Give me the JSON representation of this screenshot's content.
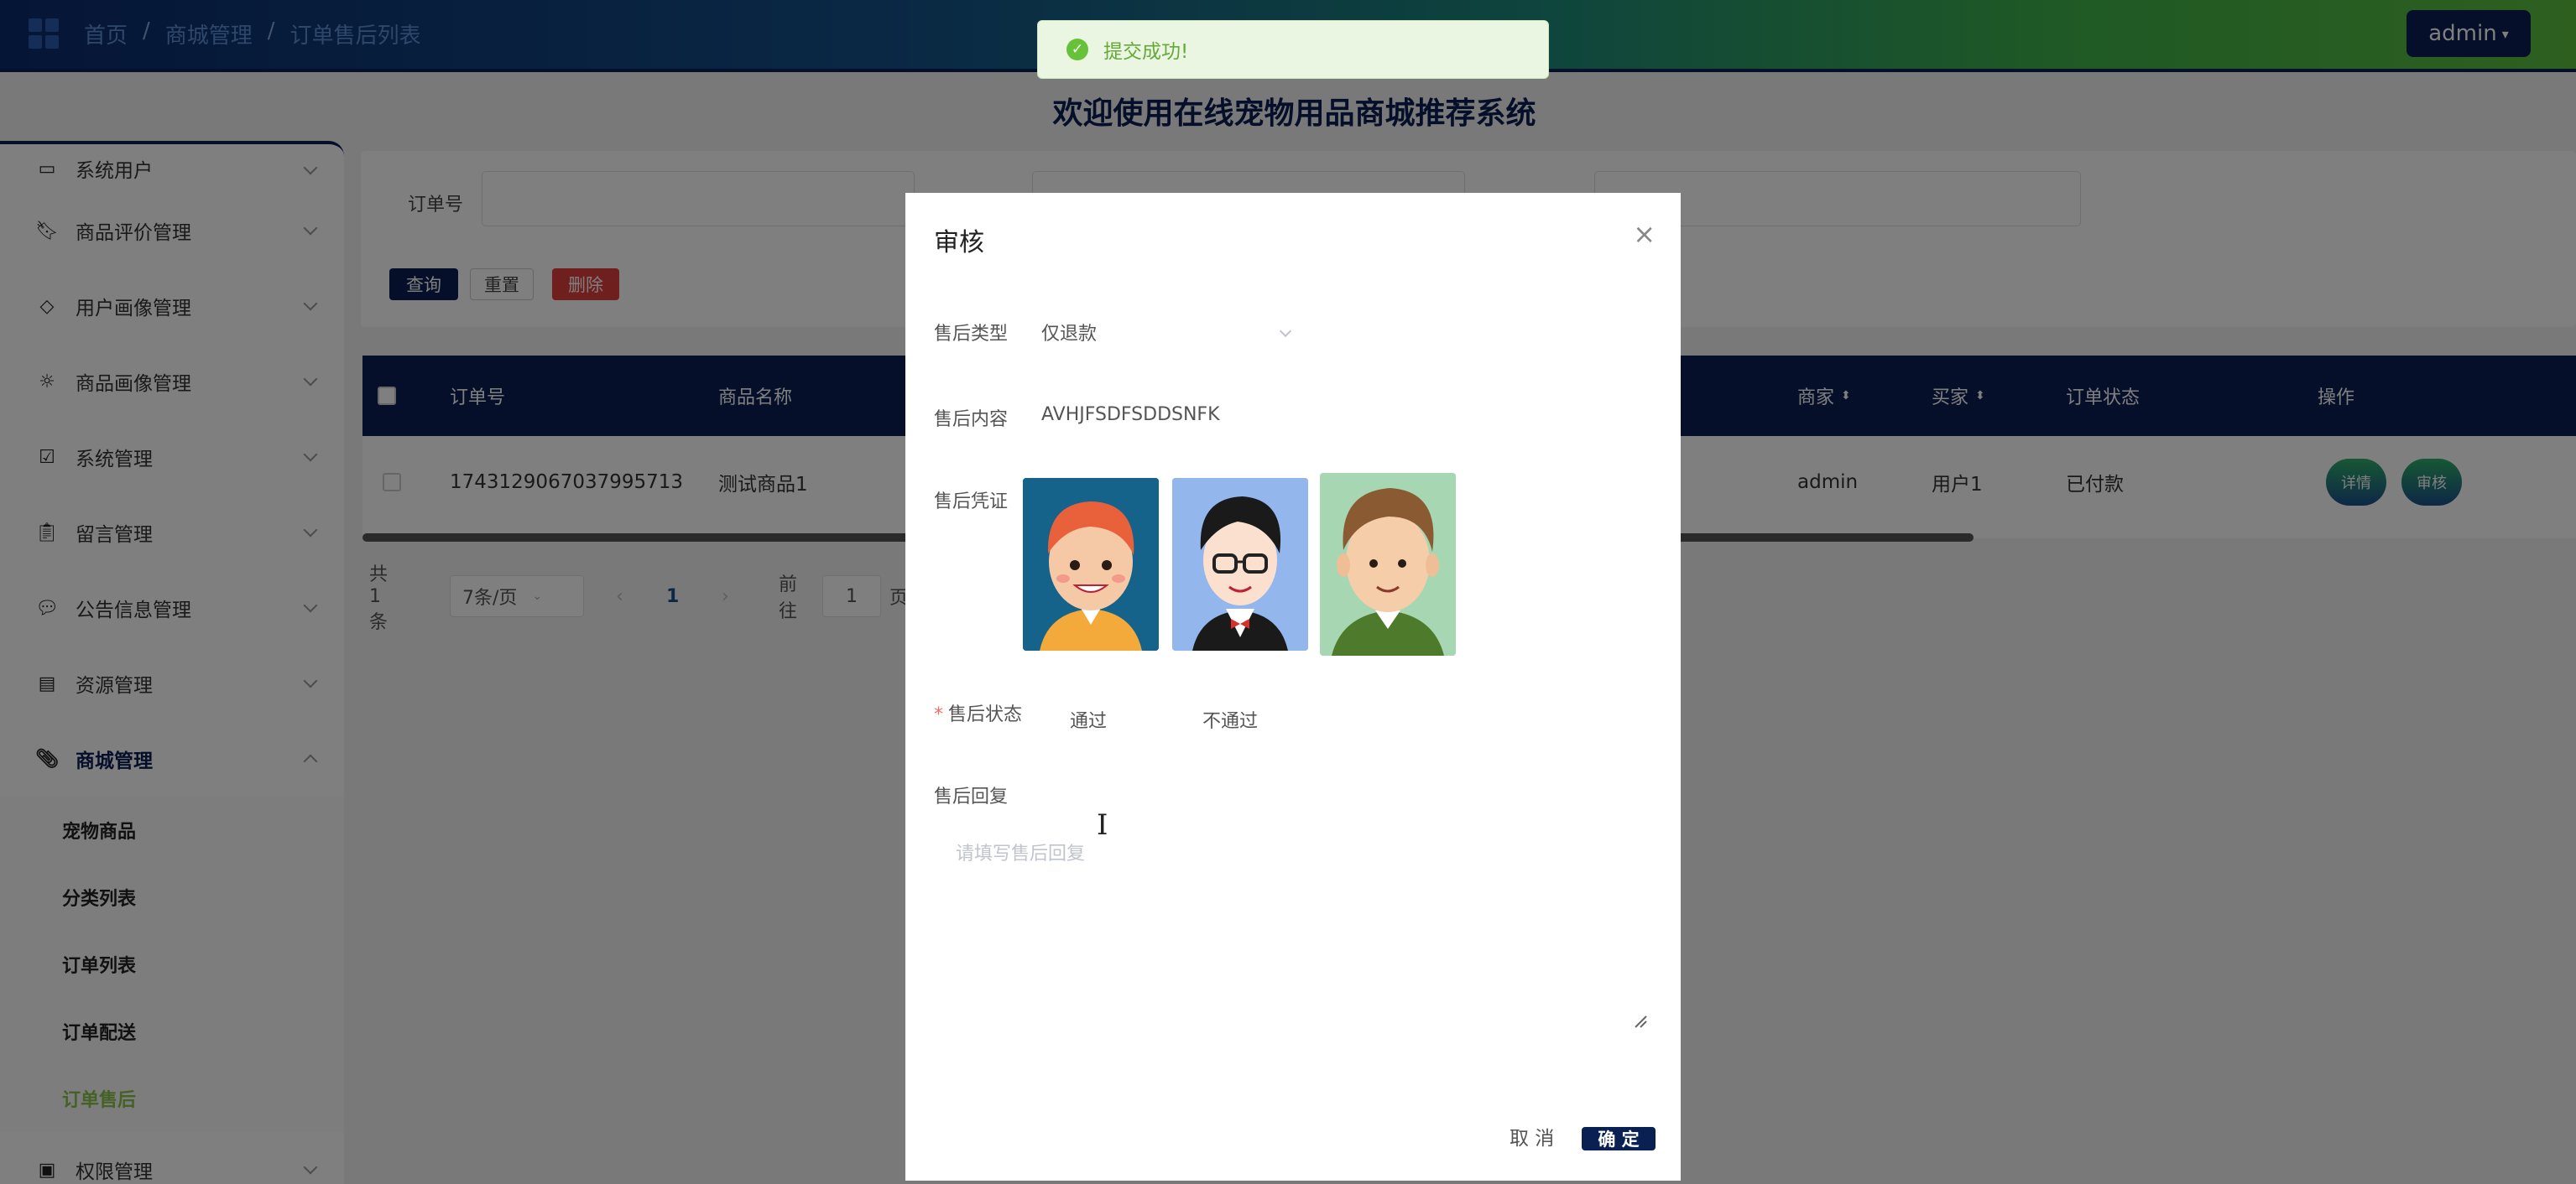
{
  "header": {
    "breadcrumb": [
      "首页",
      "商城管理",
      "订单售后列表"
    ],
    "user": "admin"
  },
  "toast": {
    "message": "提交成功!"
  },
  "site_title": "欢迎使用在线宠物用品商城推荐系统",
  "sidebar": {
    "items": [
      {
        "label": "系统用户",
        "icon": "monitor-icon"
      },
      {
        "label": "商品评价管理",
        "icon": "bookmark-icon"
      },
      {
        "label": "用户画像管理",
        "icon": "tag-icon"
      },
      {
        "label": "商品画像管理",
        "icon": "sun-icon"
      },
      {
        "label": "系统管理",
        "icon": "inbox-icon"
      },
      {
        "label": "留言管理",
        "icon": "clipboard-icon"
      },
      {
        "label": "公告信息管理",
        "icon": "message-icon"
      },
      {
        "label": "资源管理",
        "icon": "box-icon"
      },
      {
        "label": "商城管理",
        "icon": "paperclip-icon"
      }
    ],
    "sub_items": [
      "宠物商品",
      "分类列表",
      "订单列表",
      "订单配送",
      "订单售后"
    ],
    "last_item": "权限管理",
    "active_color": "#8bc34a"
  },
  "search": {
    "order_label": "订单号",
    "query_btn": "查询",
    "reset_btn": "重置",
    "delete_btn": "删除"
  },
  "table": {
    "headers": {
      "order_no": "订单号",
      "product": "商品名称",
      "merchant": "商家",
      "buyer": "买家",
      "status": "订单状态",
      "ops": "操作"
    },
    "rows": [
      {
        "order_no": "1743129067037995713",
        "product": "测试商品1",
        "merchant": "admin",
        "buyer": "用户1",
        "status": "已付款",
        "detail_btn": "详情",
        "audit_btn": "审核"
      }
    ]
  },
  "pager": {
    "total": "共 1 条",
    "page_size": "7条/页",
    "current": "1",
    "goto_label": "前往",
    "goto_value": "1",
    "page_suffix": "页"
  },
  "dialog": {
    "title": "审核",
    "type_label": "售后类型",
    "type_value": "仅退款",
    "content_label": "售后内容",
    "content_value": "AVHJFSDFSDDSNFK",
    "proof_label": "售后凭证",
    "status_label": "售后状态",
    "status_options": [
      "通过",
      "不通过"
    ],
    "reply_label": "售后回复",
    "reply_placeholder": "请填写售后回复",
    "cancel": "取 消",
    "confirm": "确 定"
  }
}
